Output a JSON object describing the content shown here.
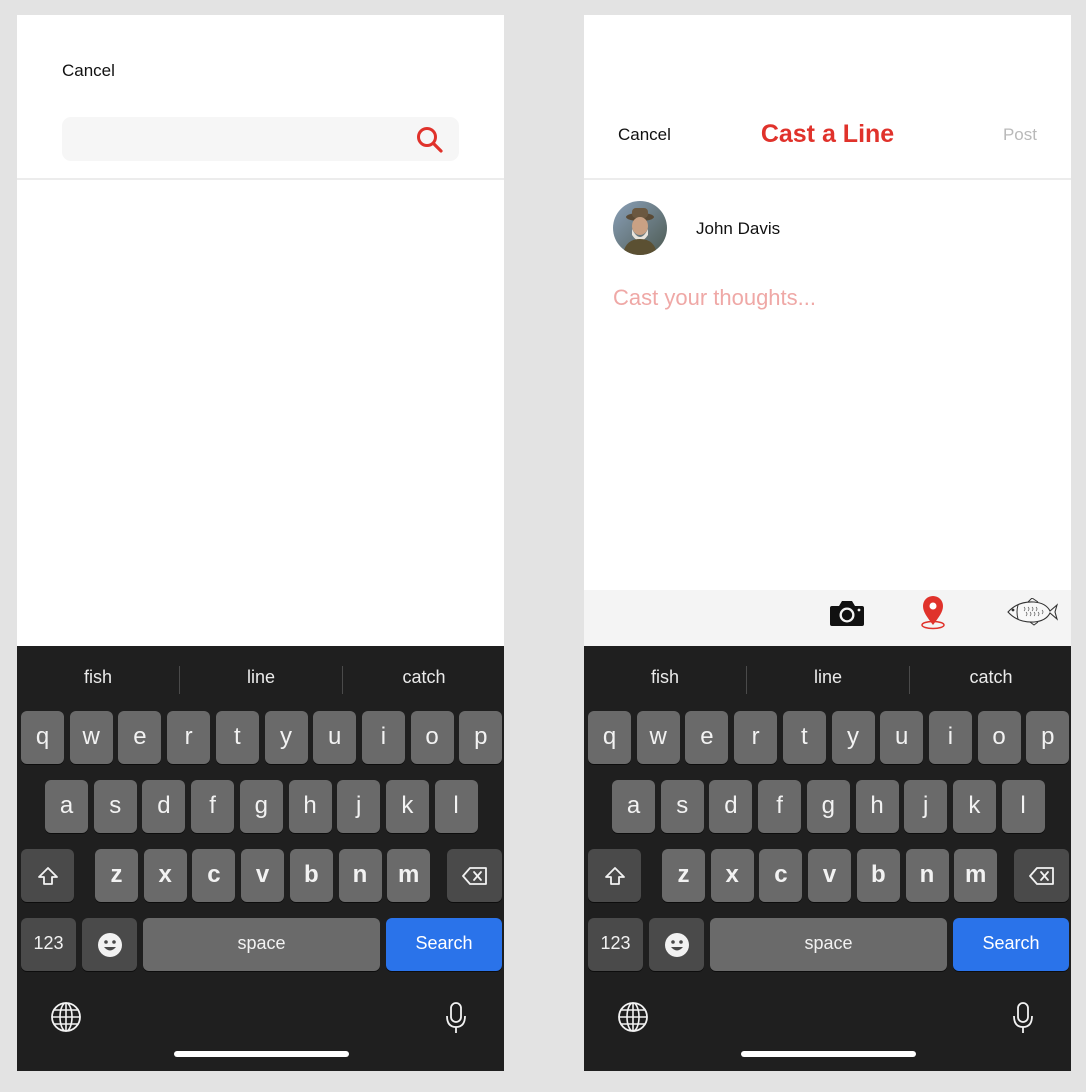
{
  "search_screen": {
    "cancel_label": "Cancel",
    "search_placeholder": ""
  },
  "compose_screen": {
    "cancel_label": "Cancel",
    "title": "Cast a Line",
    "post_label": "Post",
    "user_name": "John Davis",
    "placeholder": "Cast your thoughts...",
    "attachments": [
      "camera-icon",
      "location-pin-icon",
      "fish-icon"
    ]
  },
  "keyboard": {
    "suggestions": [
      "fish",
      "line",
      "catch"
    ],
    "row1": [
      "q",
      "w",
      "e",
      "r",
      "t",
      "y",
      "u",
      "i",
      "o",
      "p"
    ],
    "row2": [
      "a",
      "s",
      "d",
      "f",
      "g",
      "h",
      "j",
      "k",
      "l"
    ],
    "row3": [
      "z",
      "x",
      "c",
      "v",
      "b",
      "n",
      "m"
    ],
    "numbers_label": "123",
    "space_label": "space",
    "action_label": "Search"
  },
  "colors": {
    "accent": "#e0322b",
    "placeholder": "#efa8a6",
    "action_key": "#2a73ea",
    "keyboard_bg": "#1f1f1f"
  }
}
